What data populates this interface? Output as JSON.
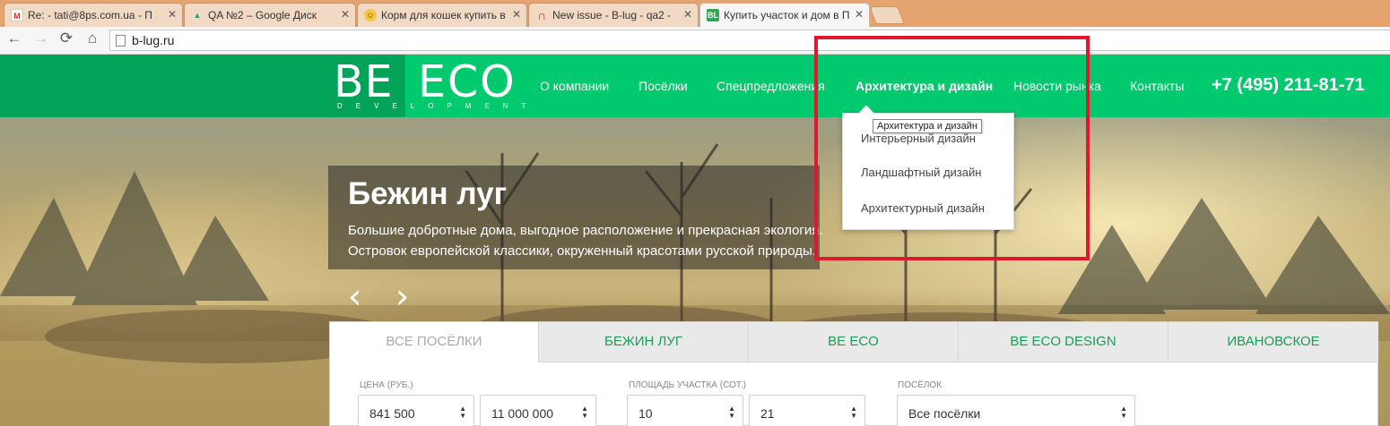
{
  "browser": {
    "tabs": [
      {
        "title": "Re: - tati@8ps.com.ua - П",
        "favicon": "M",
        "color": "#d93025"
      },
      {
        "title": "QA №2 – Google Диск",
        "favicon": "▲",
        "color": "#1fa463"
      },
      {
        "title": "Корм для кошек купить в",
        "favicon": "☺",
        "color": "#e0a030"
      },
      {
        "title": "New issue - B-lug - qa2 -",
        "favicon": "∩",
        "color": "#cc2b2b"
      },
      {
        "title": "Купить участок и дом в П",
        "favicon": "BL",
        "color": "#2fa84f"
      }
    ],
    "close_glyph": "✕",
    "nav": {
      "back": "←",
      "forward": "→",
      "reload": "⟳",
      "home": "⌂"
    },
    "url": "b-lug.ru"
  },
  "site": {
    "logo": {
      "be": "BE",
      "eco": "ECO",
      "dev": "DEVELOPMENT"
    },
    "menu": [
      {
        "label": "О компании",
        "active": false
      },
      {
        "label": "Посёлки",
        "active": false
      },
      {
        "label": "Спецпредложения",
        "active": false
      },
      {
        "label": "Архитектура и дизайн",
        "active": true
      },
      {
        "label": "Новости рынка",
        "active": false
      },
      {
        "label": "Контакты",
        "active": false
      }
    ],
    "phone": "+7 (495) 211-81-71",
    "colors": {
      "header": "#00c96e",
      "logo_block": "#00a357",
      "highlight": "#e2162c"
    }
  },
  "dropdown": {
    "tooltip": "Архитектура и дизайн",
    "items": [
      "Интерьерный дизайн",
      "Ландшафтный дизайн",
      "Архитектурный дизайн"
    ]
  },
  "hero": {
    "title": "Бежин луг",
    "lines": [
      "Большие добротные дома, выгодное расположение и прекрасная экология.",
      "Островок европейской классики, окруженный красотами русской природы."
    ],
    "prev": "‹",
    "next": "›"
  },
  "filter": {
    "tabs": [
      {
        "label": "ВСЕ ПОСЁЛКИ",
        "active": true
      },
      {
        "label": "БЕЖИН ЛУГ",
        "active": false
      },
      {
        "label": "BE ECO",
        "active": false
      },
      {
        "label": "BE ECO DESIGN",
        "active": false
      },
      {
        "label": "ИВАНОВСКОЕ",
        "active": false
      }
    ],
    "price_label": "ЦЕНА (РУБ.)",
    "price_from": "841 500",
    "price_to": "11 000 000",
    "area_label": "ПЛОЩАДЬ УЧАСТКА (СОТ.)",
    "area_from": "10",
    "area_to": "21",
    "village_label": "ПОСЁЛОК",
    "village_value": "Все посёлки"
  }
}
